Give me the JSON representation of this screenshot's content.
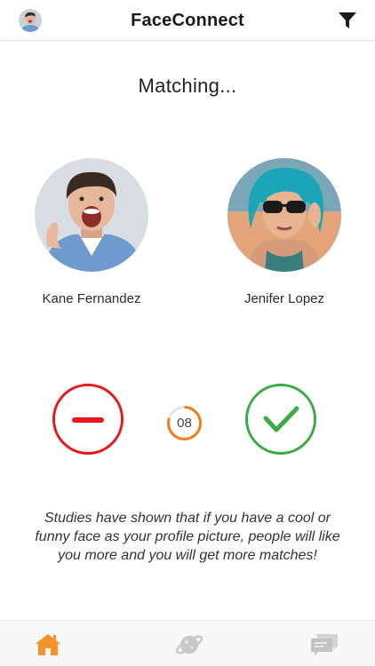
{
  "header": {
    "title": "FaceConnect",
    "avatar_icon": "user-avatar",
    "filter_icon": "filter-icon"
  },
  "matching": {
    "title": "Matching..."
  },
  "profiles": [
    {
      "name": "Kane Fernandez",
      "photo": "man-portrait"
    },
    {
      "name": "Jenifer Lopez",
      "photo": "woman-portrait"
    }
  ],
  "actions": {
    "reject_icon": "minus-icon",
    "accept_icon": "check-icon",
    "timer_value": "08",
    "timer_progress": 0.8
  },
  "tip": {
    "text": "Studies have shown that if you have a cool or funny face as your profile picture, people will like you more and you will get more matches!"
  },
  "bottom_nav": {
    "items": [
      {
        "icon": "home-icon",
        "active": true
      },
      {
        "icon": "planet-icon",
        "active": false
      },
      {
        "icon": "chat-icon",
        "active": false
      }
    ]
  },
  "colors": {
    "reject": "#e5191e",
    "accept": "#3aac44",
    "timer": "#ef7d1c",
    "active_nav": "#f39325",
    "inactive_nav": "#c8c8c8"
  }
}
